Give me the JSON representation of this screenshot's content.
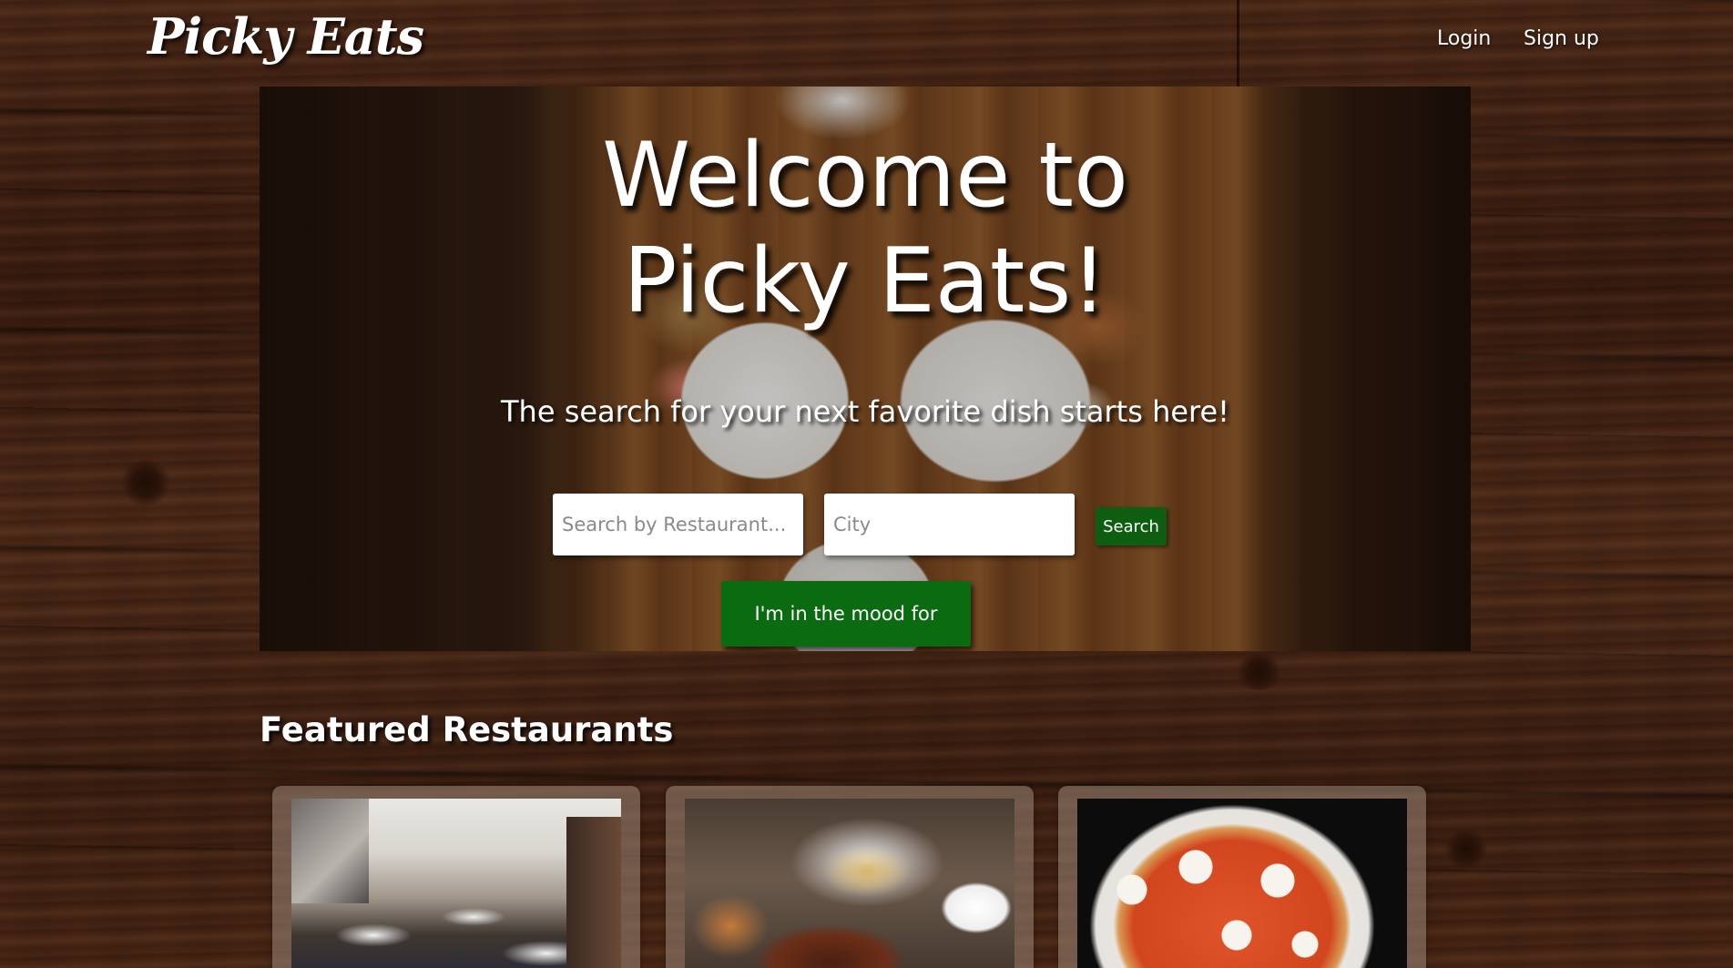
{
  "navbar": {
    "brand": "Picky Eats",
    "links": {
      "login": "Login",
      "signup": "Sign up"
    }
  },
  "hero": {
    "title": "Welcome to Picky Eats!",
    "subtitle": "The search for your next favorite dish starts here!",
    "search": {
      "restaurant_placeholder": "Search by Restaurant...",
      "city_placeholder": "City",
      "button_label": "Search"
    },
    "mood_button_label": "I'm in the mood for"
  },
  "featured": {
    "heading": "Featured Restaurants",
    "cards": [
      {
        "image": "restaurant-dining-room-photo"
      },
      {
        "image": "steak-and-appetizers-photo"
      },
      {
        "image": "margherita-pizza-photo"
      }
    ]
  },
  "colors": {
    "accent_green": "#0b6b11",
    "search_green": "#0e5e12",
    "wood_brown": "#4a2716",
    "text_white": "#ffffff"
  }
}
